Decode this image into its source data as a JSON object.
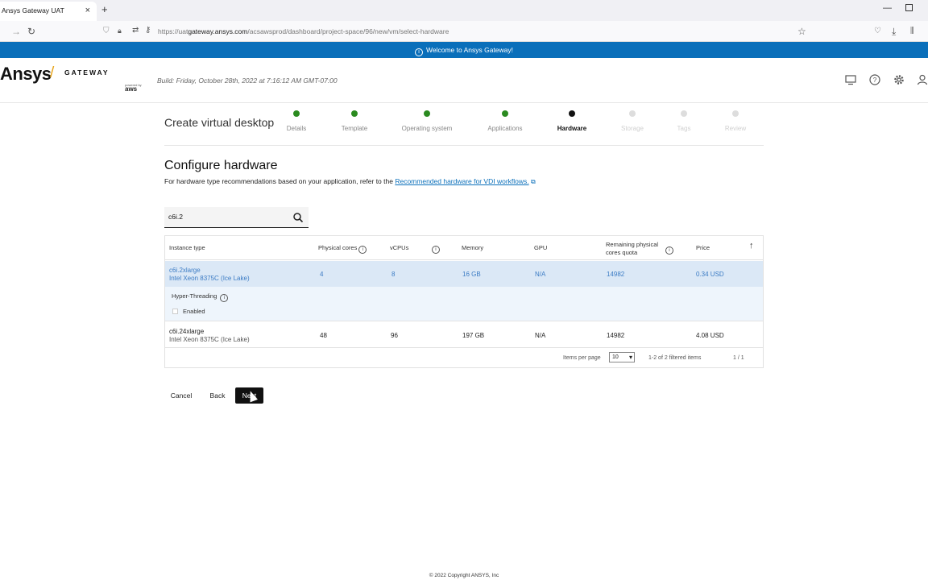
{
  "browser": {
    "tab_title": "Ansys Gateway UAT",
    "tab_close": "×",
    "new_tab": "+",
    "url_prefix": "https://uat",
    "url_domain": "gateway.ansys.com",
    "url_path": "/acsawsprod/dashboard/project-space/96/new/vm/select-hardware"
  },
  "banner": {
    "text": "Welcome to Ansys Gateway!"
  },
  "header": {
    "logo_name": "Ansys",
    "logo_product": "GATEWAY",
    "aws_powered": "powered by",
    "aws": "aws",
    "build": "Build: Friday, October 28th, 2022 at 7:16:12 AM GMT-07:00",
    "icons": [
      "desktop-icon",
      "help-icon",
      "settings-icon",
      "user-icon"
    ]
  },
  "wizard": {
    "title": "Create virtual desktop",
    "steps": [
      {
        "label": "Details",
        "state": "done"
      },
      {
        "label": "Template",
        "state": "done"
      },
      {
        "label": "Operating system",
        "state": "done"
      },
      {
        "label": "Applications",
        "state": "done"
      },
      {
        "label": "Hardware",
        "state": "current"
      },
      {
        "label": "Storage",
        "state": "future"
      },
      {
        "label": "Tags",
        "state": "future"
      },
      {
        "label": "Review",
        "state": "future"
      }
    ],
    "colors": {
      "done": "#2a8a1f",
      "current": "#111111",
      "future": "#dddddd"
    }
  },
  "configure": {
    "title": "Configure hardware",
    "description": "For hardware type recommendations based on your application, refer to the",
    "link_text": "Recommended hardware for VDI workflows."
  },
  "search": {
    "value": "c6i.2"
  },
  "table": {
    "headers": {
      "instance_type": "Instance type",
      "physical_cores": "Physical cores",
      "vcpus": "vCPUs",
      "memory": "Memory",
      "gpu": "GPU",
      "remaining_quota_1": "Remaining physical",
      "remaining_quota_2": "cores quota",
      "price": "Price"
    },
    "rows": [
      {
        "name": "c6i.2xlarge",
        "cpu": "Intel Xeon 8375C (Ice Lake)",
        "cores": "4",
        "vcpus": "8",
        "memory": "16 GB",
        "gpu": "N/A",
        "quota": "14982",
        "price": "0.34 USD"
      },
      {
        "name": "c6i.24xlarge",
        "cpu": "Intel Xeon 8375C (Ice Lake)",
        "cores": "48",
        "vcpus": "96",
        "memory": "197 GB",
        "gpu": "N/A",
        "quota": "14982",
        "price": "4.08 USD"
      }
    ],
    "hyperthreading_label": "Hyper-Threading",
    "enabled_label": "Enabled",
    "items_per_page_label": "Items per page",
    "items_per_page": "10",
    "filtered_count": "1-2 of 2 filtered items",
    "pages": "1 / 1",
    "accent": "#0a6fba"
  },
  "actions": {
    "cancel": "Cancel",
    "back": "Back",
    "next": "Next"
  },
  "footer": {
    "copyright": "© 2022 Copyright ANSYS, Inc"
  }
}
